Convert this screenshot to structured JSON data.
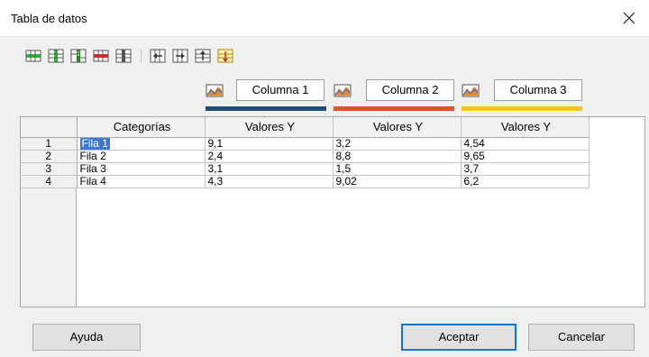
{
  "dialog": {
    "title": "Tabla de datos"
  },
  "toolbar": {
    "buttons": [
      {
        "icon": "insert-row-icon"
      },
      {
        "icon": "insert-series-icon"
      },
      {
        "icon": "insert-text-column-icon"
      },
      {
        "icon": "delete-row-icon"
      },
      {
        "icon": "delete-series-icon"
      },
      {
        "icon": "move-series-left-icon"
      },
      {
        "icon": "move-series-right-icon"
      },
      {
        "icon": "move-row-up-icon"
      },
      {
        "icon": "move-row-down-icon"
      }
    ]
  },
  "series": [
    {
      "name": "Columna 1",
      "color": "#1f4e79"
    },
    {
      "name": "Columna 2",
      "color": "#e2532b"
    },
    {
      "name": "Columna 3",
      "color": "#f5c518"
    }
  ],
  "table": {
    "headers": [
      "Categorías",
      "Valores Y",
      "Valores Y",
      "Valores Y"
    ],
    "rows": [
      {
        "num": "1",
        "category": "Fila 1",
        "values": [
          "9,1",
          "3,2",
          "4,54"
        ]
      },
      {
        "num": "2",
        "category": "Fila 2",
        "values": [
          "2,4",
          "8,8",
          "9,65"
        ]
      },
      {
        "num": "3",
        "category": "Fila 3",
        "values": [
          "3,1",
          "1,5",
          "3,7"
        ]
      },
      {
        "num": "4",
        "category": "Fila 4",
        "values": [
          "4,3",
          "9,02",
          "6,2"
        ]
      }
    ]
  },
  "buttons": {
    "help": "Ayuda",
    "ok": "Aceptar",
    "cancel": "Cancelar"
  },
  "colors": {
    "selection": "#3c78d8",
    "default_button_border": "#0078d7"
  }
}
